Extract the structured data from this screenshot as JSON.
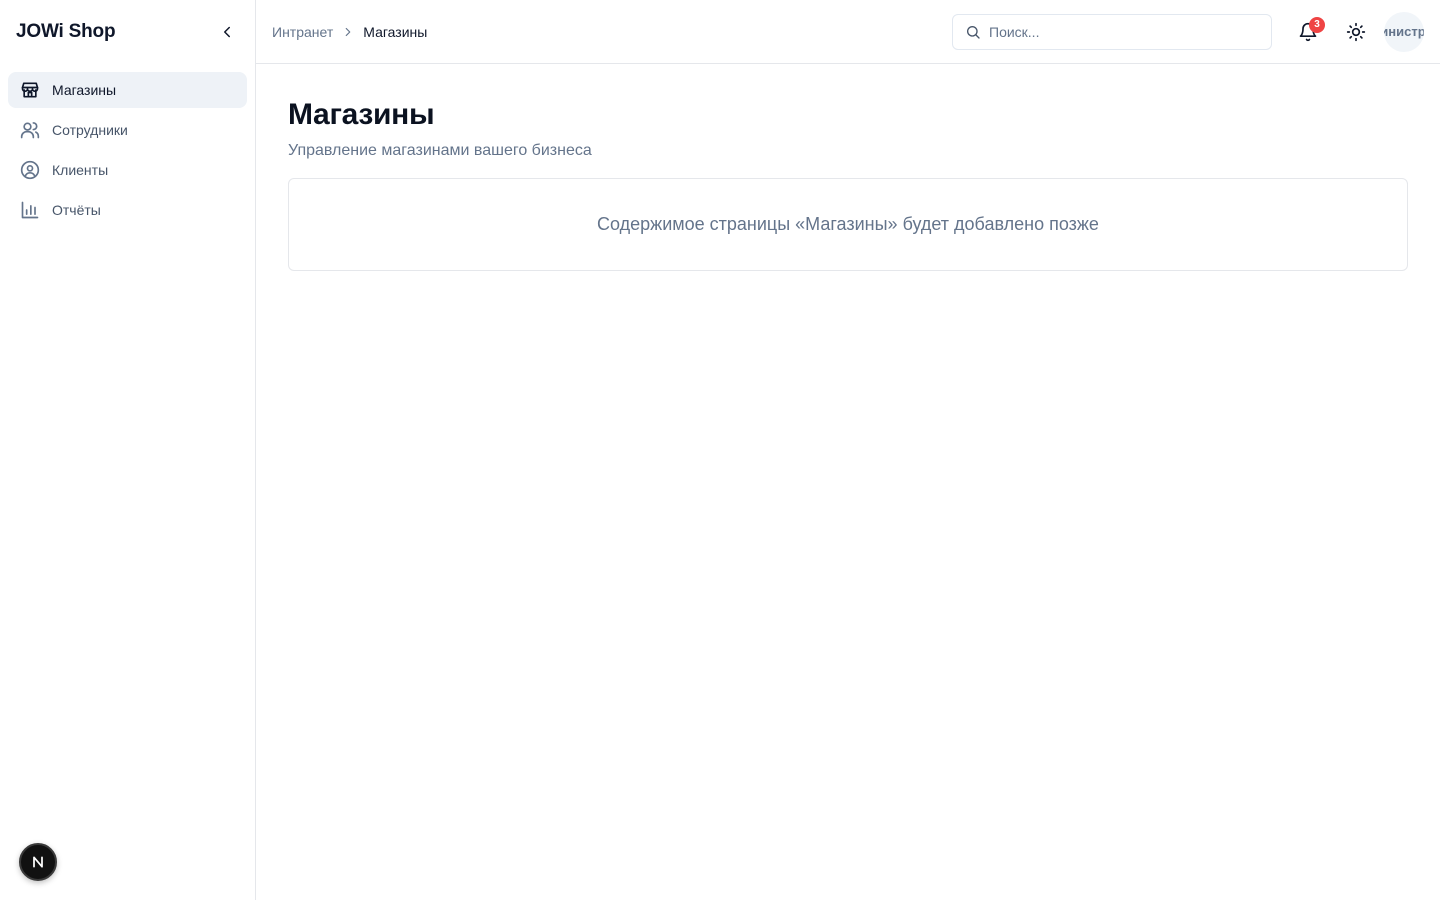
{
  "sidebar": {
    "brand": "JOWi Shop",
    "items": [
      {
        "label": "Магазины",
        "icon": "store-icon",
        "active": true
      },
      {
        "label": "Сотрудники",
        "icon": "users-icon",
        "active": false
      },
      {
        "label": "Клиенты",
        "icon": "user-circle-icon",
        "active": false
      },
      {
        "label": "Отчёты",
        "icon": "bar-chart-icon",
        "active": false
      }
    ]
  },
  "header": {
    "breadcrumb": {
      "root": "Интранет",
      "current": "Магазины"
    },
    "search": {
      "placeholder": "Поиск..."
    },
    "notifications": {
      "count": "3"
    },
    "avatar_text": "Администратор"
  },
  "main": {
    "title": "Магазины",
    "subtitle": "Управление магазинами вашего бизнеса",
    "placeholder": "Содержимое страницы «Магазины» будет добавлено позже"
  },
  "colors": {
    "accent_active_bg": "#eef2f7",
    "badge": "#ef4444"
  }
}
